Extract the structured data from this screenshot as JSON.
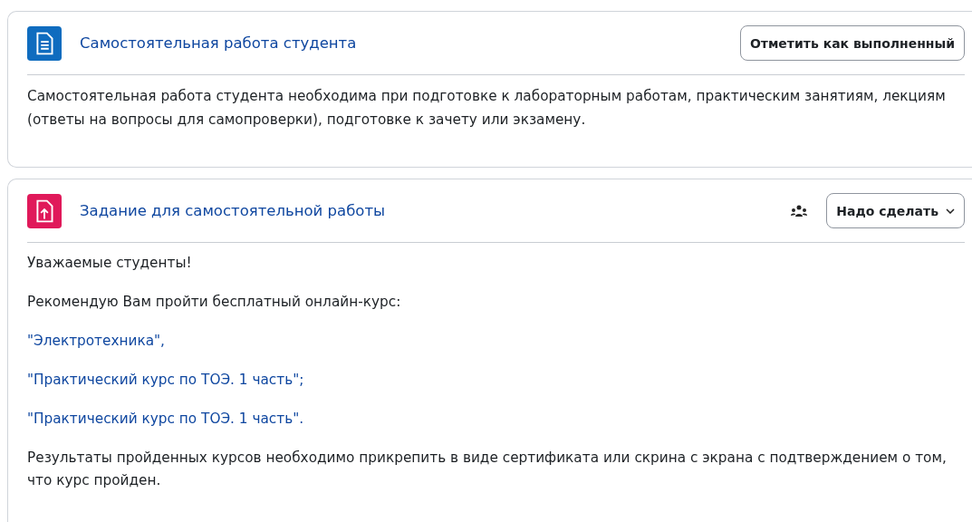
{
  "cards": [
    {
      "title": "Самостоятельная работа студента",
      "action": {
        "kind": "button",
        "label": "Отметить как выполненный"
      },
      "body": [
        {
          "kind": "text",
          "text": "Самостоятельная работа студента необходима при подготовке к лабораторным работам, практическим занятиям, лекциям (ответы на вопросы для самопроверки), подготовке к зачету или экзамену."
        }
      ]
    },
    {
      "title": "Задание для самостоятельной работы",
      "action": {
        "kind": "dropdown",
        "label": "Надо сделать"
      },
      "body": [
        {
          "kind": "text",
          "text": "Уважаемые студенты!"
        },
        {
          "kind": "text",
          "text": "Рекомендую Вам пройти бесплатный онлайн-курс:"
        },
        {
          "kind": "link",
          "text": "\"Электротехника\","
        },
        {
          "kind": "link",
          "text": "\"Практический курс по ТОЭ. 1 часть\";"
        },
        {
          "kind": "link",
          "text": "\"Практический курс по ТОЭ. 1 часть\"."
        },
        {
          "kind": "text",
          "text": "Результаты пройденных курсов необходимо прикрепить в виде сертификата или скрина с экрана с подтверждением о том, что курс пройден."
        }
      ]
    }
  ]
}
